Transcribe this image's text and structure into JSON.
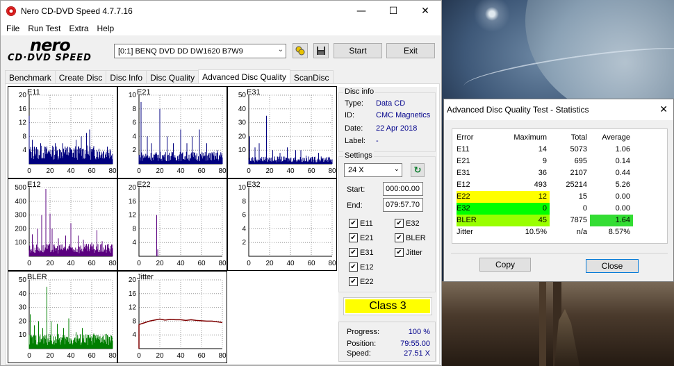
{
  "main_window": {
    "title": "Nero CD-DVD Speed 4.7.7.16",
    "menu": [
      "File",
      "Run Test",
      "Extra",
      "Help"
    ],
    "logo_top": "nero",
    "logo_bottom": "CD·DVD SPEED",
    "drive": "[0:1]   BENQ DVD DD DW1620 B7W9",
    "start_label": "Start",
    "exit_label": "Exit",
    "tabs": [
      "Benchmark",
      "Create Disc",
      "Disc Info",
      "Disc Quality",
      "Advanced Disc Quality",
      "ScanDisc"
    ],
    "active_tab": 4
  },
  "disc_info": {
    "title": "Disc info",
    "rows": [
      {
        "key": "Type:",
        "value": "Data CD"
      },
      {
        "key": "ID:",
        "value": "CMC Magnetics"
      },
      {
        "key": "Date:",
        "value": "22 Apr 2018"
      },
      {
        "key": "Label:",
        "value": "-"
      }
    ]
  },
  "settings": {
    "title": "Settings",
    "speed": "24 X",
    "start_label": "Start:",
    "start_value": "000:00.00",
    "end_label": "End:",
    "end_value": "079:57.70",
    "checkboxes": [
      {
        "label": "E11",
        "checked": true
      },
      {
        "label": "E32",
        "checked": true
      },
      {
        "label": "E21",
        "checked": true
      },
      {
        "label": "BLER",
        "checked": true
      },
      {
        "label": "E31",
        "checked": true
      },
      {
        "label": "Jitter",
        "checked": true
      },
      {
        "label": "E12",
        "checked": true
      },
      {
        "label": "E22",
        "checked": true
      }
    ]
  },
  "class_label": "Class 3",
  "class_color": "#ffff00",
  "progress": {
    "progress_label": "Progress:",
    "progress_value": "100 %",
    "position_label": "Position:",
    "position_value": "79:55.00",
    "speed_label": "Speed:",
    "speed_value": "27.51 X"
  },
  "chart_data": [
    {
      "name": "E11",
      "type": "bar",
      "color": "#00007f",
      "ylim": [
        0,
        20
      ],
      "yticks": [
        4,
        8,
        12,
        16,
        20
      ],
      "xticks": [
        0,
        20,
        40,
        60,
        80
      ],
      "xlim": [
        0,
        80
      ],
      "peaks": [
        [
          0,
          14
        ],
        [
          3,
          7
        ],
        [
          5,
          5
        ],
        [
          11,
          6
        ],
        [
          20,
          4
        ],
        [
          25,
          6
        ],
        [
          30,
          4
        ],
        [
          32,
          6
        ],
        [
          37,
          5
        ],
        [
          45,
          7
        ],
        [
          50,
          8
        ],
        [
          55,
          9
        ],
        [
          58,
          10
        ],
        [
          65,
          4
        ],
        [
          70,
          3
        ],
        [
          75,
          5
        ]
      ],
      "baseline": 3
    },
    {
      "name": "E21",
      "type": "bar",
      "color": "#00007f",
      "ylim": [
        0,
        10
      ],
      "yticks": [
        2,
        4,
        6,
        8,
        10
      ],
      "xticks": [
        0,
        20,
        40,
        60,
        80
      ],
      "xlim": [
        0,
        80
      ],
      "peaks": [
        [
          2,
          9
        ],
        [
          8,
          4
        ],
        [
          12,
          3
        ],
        [
          20,
          8
        ],
        [
          27,
          4
        ],
        [
          33,
          3
        ],
        [
          40,
          5
        ],
        [
          46,
          3
        ],
        [
          51,
          4
        ],
        [
          58,
          5
        ],
        [
          65,
          3
        ],
        [
          75,
          2
        ]
      ],
      "baseline": 1
    },
    {
      "name": "E31",
      "type": "bar",
      "color": "#00007f",
      "ylim": [
        0,
        50
      ],
      "yticks": [
        10,
        20,
        30,
        40,
        50
      ],
      "xticks": [
        0,
        20,
        40,
        60,
        80
      ],
      "xlim": [
        0,
        80
      ],
      "peaks": [
        [
          1,
          20
        ],
        [
          6,
          12
        ],
        [
          10,
          15
        ],
        [
          17,
          35
        ],
        [
          23,
          10
        ],
        [
          30,
          8
        ],
        [
          37,
          12
        ],
        [
          45,
          10
        ],
        [
          50,
          10
        ],
        [
          55,
          6
        ],
        [
          60,
          5
        ],
        [
          67,
          8
        ],
        [
          75,
          5
        ]
      ],
      "baseline": 3
    },
    {
      "name": "E12",
      "type": "bar",
      "color": "#5a007f",
      "ylim": [
        0,
        500
      ],
      "yticks": [
        100,
        200,
        300,
        400,
        500
      ],
      "xticks": [
        0,
        20,
        40,
        60,
        80
      ],
      "xlim": [
        0,
        80
      ],
      "peaks": [
        [
          3,
          160
        ],
        [
          8,
          200
        ],
        [
          12,
          300
        ],
        [
          16,
          490
        ],
        [
          20,
          310
        ],
        [
          22,
          200
        ],
        [
          28,
          130
        ],
        [
          35,
          150
        ],
        [
          40,
          240
        ],
        [
          47,
          150
        ],
        [
          52,
          120
        ],
        [
          60,
          100
        ],
        [
          65,
          190
        ],
        [
          70,
          110
        ],
        [
          76,
          90
        ]
      ],
      "baseline": 50
    },
    {
      "name": "E22",
      "type": "bar",
      "color": "#5a007f",
      "ylim": [
        0,
        20
      ],
      "yticks": [
        4,
        8,
        12,
        16,
        20
      ],
      "xticks": [
        0,
        20,
        40,
        60,
        80
      ],
      "xlim": [
        0,
        80
      ],
      "peaks": [
        [
          17,
          12
        ],
        [
          18,
          2
        ]
      ],
      "baseline": 0
    },
    {
      "name": "E32",
      "type": "bar",
      "color": "#5a007f",
      "ylim": [
        0,
        10
      ],
      "yticks": [
        2,
        4,
        6,
        8,
        10
      ],
      "xticks": [
        0,
        20,
        40,
        60,
        80
      ],
      "xlim": [
        0,
        80
      ],
      "peaks": [],
      "baseline": 0
    },
    {
      "name": "BLER",
      "type": "bar",
      "color": "#007f00",
      "ylim": [
        0,
        50
      ],
      "yticks": [
        10,
        20,
        30,
        40,
        50
      ],
      "xticks": [
        0,
        20,
        40,
        60,
        80
      ],
      "xlim": [
        0,
        80
      ],
      "peaks": [
        [
          1,
          25
        ],
        [
          5,
          17
        ],
        [
          9,
          20
        ],
        [
          13,
          15
        ],
        [
          17,
          45
        ],
        [
          21,
          20
        ],
        [
          27,
          18
        ],
        [
          33,
          15
        ],
        [
          38,
          22
        ],
        [
          45,
          12
        ],
        [
          51,
          15
        ],
        [
          57,
          10
        ],
        [
          62,
          11
        ],
        [
          68,
          9
        ],
        [
          75,
          10
        ]
      ],
      "baseline": 6
    },
    {
      "name": "Jitter",
      "type": "line",
      "color": "#7f0000",
      "ylim": [
        0,
        20
      ],
      "yticks": [
        4,
        8,
        12,
        16,
        20
      ],
      "xticks": [
        0,
        20,
        40,
        60,
        80
      ],
      "xlim": [
        0,
        80
      ],
      "points": [
        [
          0,
          7
        ],
        [
          5,
          7.5
        ],
        [
          10,
          8
        ],
        [
          15,
          8.3
        ],
        [
          20,
          8.6
        ],
        [
          25,
          8.3
        ],
        [
          30,
          8.5
        ],
        [
          35,
          8.4
        ],
        [
          40,
          8.4
        ],
        [
          45,
          8.2
        ],
        [
          50,
          8.4
        ],
        [
          55,
          8.2
        ],
        [
          60,
          8.1
        ],
        [
          65,
          8.0
        ],
        [
          70,
          8.0
        ],
        [
          75,
          7.8
        ],
        [
          80,
          7.6
        ]
      ]
    }
  ],
  "stats": {
    "title": "Advanced Disc Quality Test - Statistics",
    "columns": [
      "Error",
      "Maximum",
      "Total",
      "Average"
    ],
    "rows": [
      {
        "name": "E11",
        "max": "14",
        "total": "5073",
        "avg": "1.06",
        "hl_name": "",
        "hl_max": "",
        "hl_avg": ""
      },
      {
        "name": "E21",
        "max": "9",
        "total": "695",
        "avg": "0.14",
        "hl_name": "",
        "hl_max": "",
        "hl_avg": ""
      },
      {
        "name": "E31",
        "max": "36",
        "total": "2107",
        "avg": "0.44",
        "hl_name": "",
        "hl_max": "",
        "hl_avg": ""
      },
      {
        "name": "E12",
        "max": "493",
        "total": "25214",
        "avg": "5.26",
        "hl_name": "",
        "hl_max": "",
        "hl_avg": ""
      },
      {
        "name": "E22",
        "max": "12",
        "total": "15",
        "avg": "0.00",
        "hl_name": "#ffff00",
        "hl_max": "#ffff00",
        "hl_avg": ""
      },
      {
        "name": "E32",
        "max": "0",
        "total": "0",
        "avg": "0.00",
        "hl_name": "#00ff00",
        "hl_max": "#00ff00",
        "hl_avg": ""
      },
      {
        "name": "BLER",
        "max": "45",
        "total": "7875",
        "avg": "1.64",
        "hl_name": "#99ff00",
        "hl_max": "#99ff00",
        "hl_avg": "#33dd33"
      },
      {
        "name": "Jitter",
        "max": "10.5%",
        "total": "n/a",
        "avg": "8.57%",
        "hl_name": "",
        "hl_max": "",
        "hl_avg": ""
      }
    ],
    "copy_label": "Copy",
    "close_label": "Close"
  }
}
